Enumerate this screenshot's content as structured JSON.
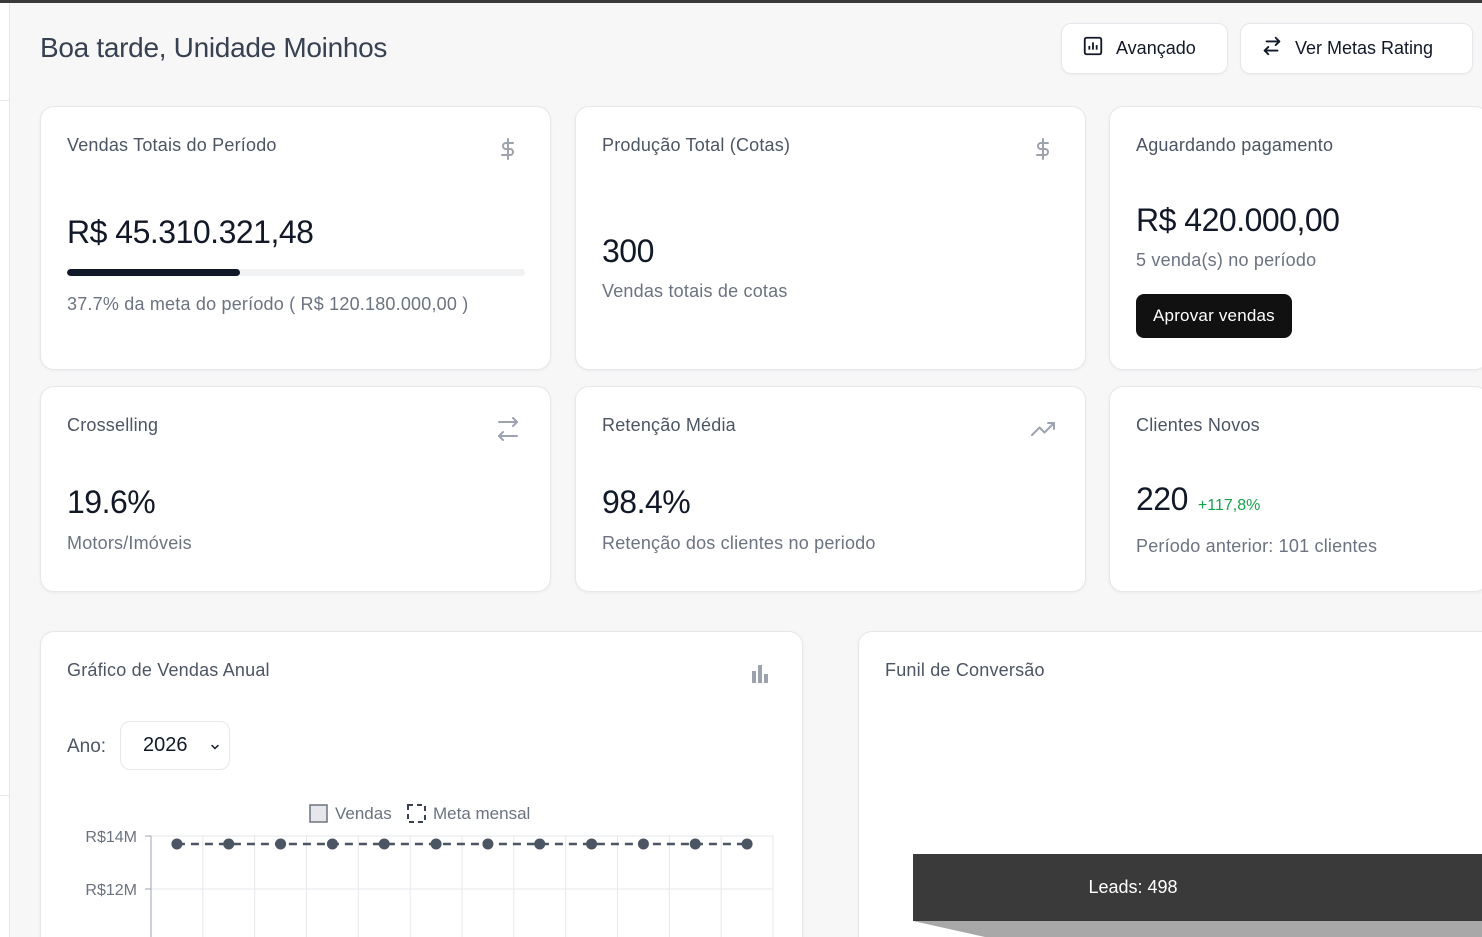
{
  "header": {
    "greeting": "Boa tarde, Unidade Moinhos",
    "advanced_label": "Avançado",
    "ratings_label": "Ver Metas Rating"
  },
  "cards": {
    "total_sales": {
      "title": "Vendas Totais do Período",
      "icon": "dollar-icon",
      "value": "R$ 45.310.321,48",
      "progress_percent": 37.7,
      "caption": "37.7% da meta do período ( R$ 120.180.000,00 )"
    },
    "production": {
      "title": "Produção Total (Cotas)",
      "icon": "dollar-icon",
      "value": "300",
      "caption": "Vendas totais de cotas"
    },
    "awaiting_payment": {
      "title": "Aguardando pagamento",
      "value": "R$ 420.000,00",
      "caption": "5 venda(s) no período",
      "button_label": "Aprovar vendas"
    },
    "crosselling": {
      "title": "Crosselling",
      "icon": "swap-icon",
      "value": "19.6%",
      "caption": "Motors/Imóveis"
    },
    "retention": {
      "title": "Retenção Média",
      "icon": "trending-up-icon",
      "value": "98.4%",
      "caption": "Retenção dos clientes no periodo"
    },
    "new_clients": {
      "title": "Clientes Novos",
      "value": "220",
      "growth": "+117,8%",
      "caption": "Período anterior: 101 clientes"
    }
  },
  "annual_chart": {
    "title": "Gráfico de Vendas Anual",
    "icon": "bar-chart-icon",
    "year_label": "Ano:",
    "year_value": "2026"
  },
  "funnel": {
    "title": "Funil de Conversão",
    "leads_label": "Leads: 498"
  },
  "colors": {
    "accent_dark": "#111111",
    "growth_green": "#16a34a",
    "funnel_bar": "#3a3a3a"
  },
  "chart_data": {
    "type": "line",
    "series": [
      {
        "name": "Vendas",
        "values": []
      },
      {
        "name": "Meta mensal",
        "values": [
          13.7,
          13.7,
          13.7,
          13.7,
          13.7,
          13.7,
          13.7,
          13.7,
          13.7,
          13.7,
          13.7,
          13.7
        ]
      }
    ],
    "y_tick_labels": [
      "R$14M",
      "R$12M"
    ],
    "y_ticks": [
      14,
      12
    ],
    "legend": "top-center",
    "grid": true
  }
}
